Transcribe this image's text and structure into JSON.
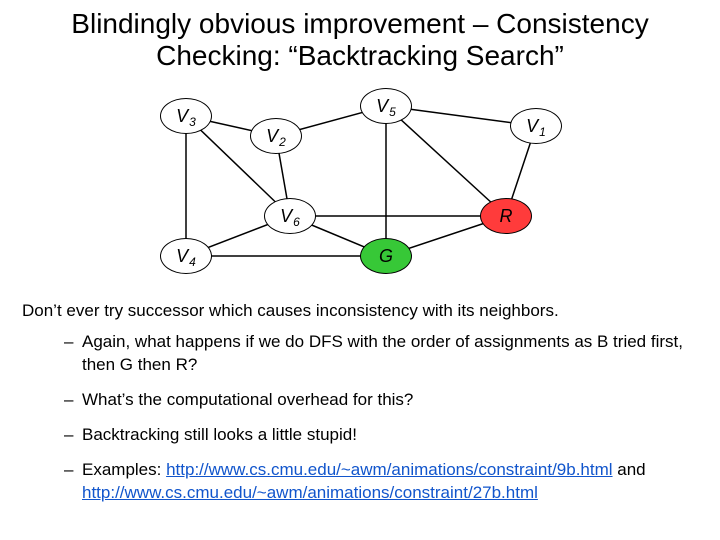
{
  "title": "Blindingly obvious improvement – Consistency Checking: “Backtracking Search”",
  "graph": {
    "nodes": {
      "v1": {
        "letter": "V",
        "sub": "1",
        "color": "none"
      },
      "v2": {
        "letter": "V",
        "sub": "2",
        "color": "none"
      },
      "v3": {
        "letter": "V",
        "sub": "3",
        "color": "none"
      },
      "v4": {
        "letter": "V",
        "sub": "4",
        "color": "none"
      },
      "v5": {
        "letter": "V",
        "sub": "5",
        "color": "none"
      },
      "v6": {
        "letter": "V",
        "sub": "6",
        "color": "none"
      },
      "r": {
        "letter": "R",
        "sub": "",
        "color": "R"
      },
      "g": {
        "letter": "G",
        "sub": "",
        "color": "G"
      }
    },
    "edges": [
      [
        "v3",
        "v2"
      ],
      [
        "v3",
        "v4"
      ],
      [
        "v3",
        "v6"
      ],
      [
        "v2",
        "v5"
      ],
      [
        "v2",
        "v6"
      ],
      [
        "v5",
        "v1"
      ],
      [
        "v5",
        "g"
      ],
      [
        "v5",
        "r"
      ],
      [
        "v6",
        "r"
      ],
      [
        "v6",
        "g"
      ],
      [
        "v6",
        "v4"
      ],
      [
        "v4",
        "g"
      ],
      [
        "v1",
        "r"
      ],
      [
        "r",
        "g"
      ]
    ]
  },
  "body": {
    "intro": "Don’t ever try successor which causes inconsistency with its neighbors.",
    "bullets": [
      {
        "t": "Again, what happens if we do DFS with the order of assignments as B tried first, then G then R?"
      },
      {
        "t": "What’s the computational overhead for this?"
      },
      {
        "t": "Backtracking still looks a little stupid!"
      },
      {
        "prefix": "Examples: ",
        "link1_text": "http://www.cs.cmu.edu/~awm/animations/constraint/9b.html",
        "mid": " and ",
        "link2_text": "http://www.cs.cmu.edu/~awm/animations/constraint/27b.html"
      }
    ]
  }
}
